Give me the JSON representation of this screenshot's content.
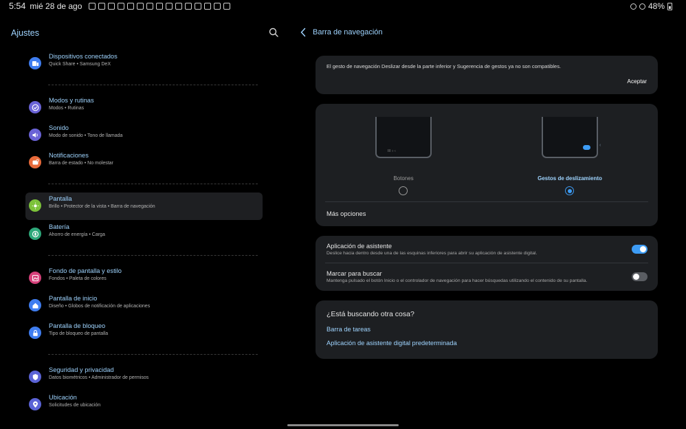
{
  "status": {
    "time": "5:54",
    "date": "mié 28 de ago",
    "battery": "48%"
  },
  "settings": {
    "title": "Ajustes",
    "items": [
      {
        "title": "Dispositivos conectados",
        "sub": "Quick Share  •  Samsung DeX",
        "color": "#3f7df0",
        "icon": "devices-icon"
      },
      {
        "title": "Modos y rutinas",
        "sub": "Modos  •  Rutinas",
        "color": "#6a63d6",
        "icon": "check-icon"
      },
      {
        "title": "Sonido",
        "sub": "Modo de sonido  •  Tono de llamada",
        "color": "#6a63d6",
        "icon": "speaker-icon"
      },
      {
        "title": "Notificaciones",
        "sub": "Barra de estado  •  No molestar",
        "color": "#e86a3a",
        "icon": "bell-icon"
      },
      {
        "title": "Pantalla",
        "sub": "Brillo  •  Protector de la vista  •  Barra de navegación",
        "color": "#7cc23a",
        "icon": "sun-icon"
      },
      {
        "title": "Batería",
        "sub": "Ahorro de energía  •  Carga",
        "color": "#2ea87a",
        "icon": "battery-icon"
      },
      {
        "title": "Fondo de pantalla y estilo",
        "sub": "Fondos  •  Paleta de colores",
        "color": "#d6407a",
        "icon": "image-icon"
      },
      {
        "title": "Pantalla de inicio",
        "sub": "Diseño  •  Globos de notificación de aplicaciones",
        "color": "#3f7df0",
        "icon": "home-icon"
      },
      {
        "title": "Pantalla de bloqueo",
        "sub": "Tipo de bloqueo de pantalla",
        "color": "#3f7df0",
        "icon": "lock-icon"
      },
      {
        "title": "Seguridad y privacidad",
        "sub": "Datos biométricos  •  Administrador de permisos",
        "color": "#5b63d6",
        "icon": "shield-icon"
      },
      {
        "title": "Ubicación",
        "sub": "Solicitudes de ubicación",
        "color": "#5b63d6",
        "icon": "location-icon"
      }
    ]
  },
  "nav": {
    "title": "Barra de navegación",
    "notice": "El gesto de navegación Deslizar desde la parte inferior y Sugerencia de gestos ya no son compatibles.",
    "accept": "Aceptar",
    "option_buttons": "Botones",
    "option_gestures": "Gestos de deslizamiento",
    "phone_buttons_glyphs": "III  ○  ‹",
    "more_options": "Más opciones",
    "assistant_title": "Aplicación de asistente",
    "assistant_sub": "Deslice hacia dentro desde una de las esquinas inferiores para abrir su aplicación de asistente digital.",
    "search_title": "Marcar para buscar",
    "search_sub": "Mantenga pulsado el botón Inicio o el controlador de navegación para hacer búsquedas utilizando el contenido de su pantalla.",
    "look_title": "¿Está buscando otra cosa?",
    "link_taskbar": "Barra de tareas",
    "link_assistant": "Aplicación de asistente digital predeterminada"
  },
  "colors": {
    "accent": "#3d9cf5",
    "link": "#9fd4ff"
  }
}
